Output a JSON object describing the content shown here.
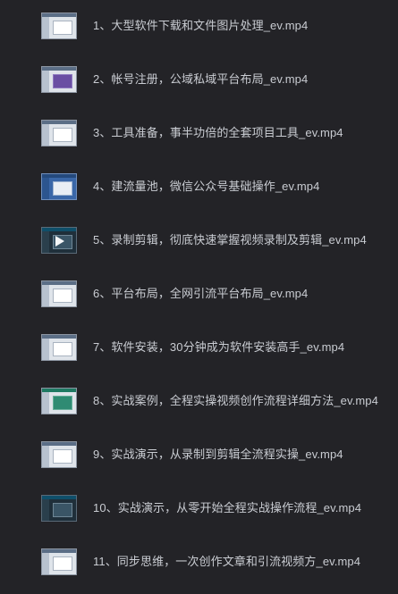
{
  "files": [
    {
      "name": "1、大型软件下载和文件图片处理_ev.mp4",
      "thumbnail": "video-thumbnail-light"
    },
    {
      "name": "2、帐号注册，公域私域平台布局_ev.mp4",
      "thumbnail": "video-thumbnail-purple"
    },
    {
      "name": "3、工具准备，事半功倍的全套项目工具_ev.mp4",
      "thumbnail": "video-thumbnail-light"
    },
    {
      "name": "4、建流量池，微信公众号基础操作_ev.mp4",
      "thumbnail": "video-thumbnail-blue"
    },
    {
      "name": "5、录制剪辑，彻底快速掌握视频录制及剪辑_ev.mp4",
      "thumbnail": "video-thumbnail-dark"
    },
    {
      "name": "6、平台布局，全网引流平台布局_ev.mp4",
      "thumbnail": "video-thumbnail-light"
    },
    {
      "name": "7、软件安装，30分钟成为软件安装高手_ev.mp4",
      "thumbnail": "video-thumbnail-light"
    },
    {
      "name": "8、实战案例，全程实操视频创作流程详细方法_ev.mp4",
      "thumbnail": "video-thumbnail-green"
    },
    {
      "name": "9、实战演示，从录制到剪辑全流程实操_ev.mp4",
      "thumbnail": "video-thumbnail-light"
    },
    {
      "name": "10、实战演示，从零开始全程实战操作流程_ev.mp4",
      "thumbnail": "video-thumbnail-dark"
    },
    {
      "name": "11、同步思维，一次创作文章和引流视频方_ev.mp4",
      "thumbnail": "video-thumbnail-light"
    }
  ]
}
